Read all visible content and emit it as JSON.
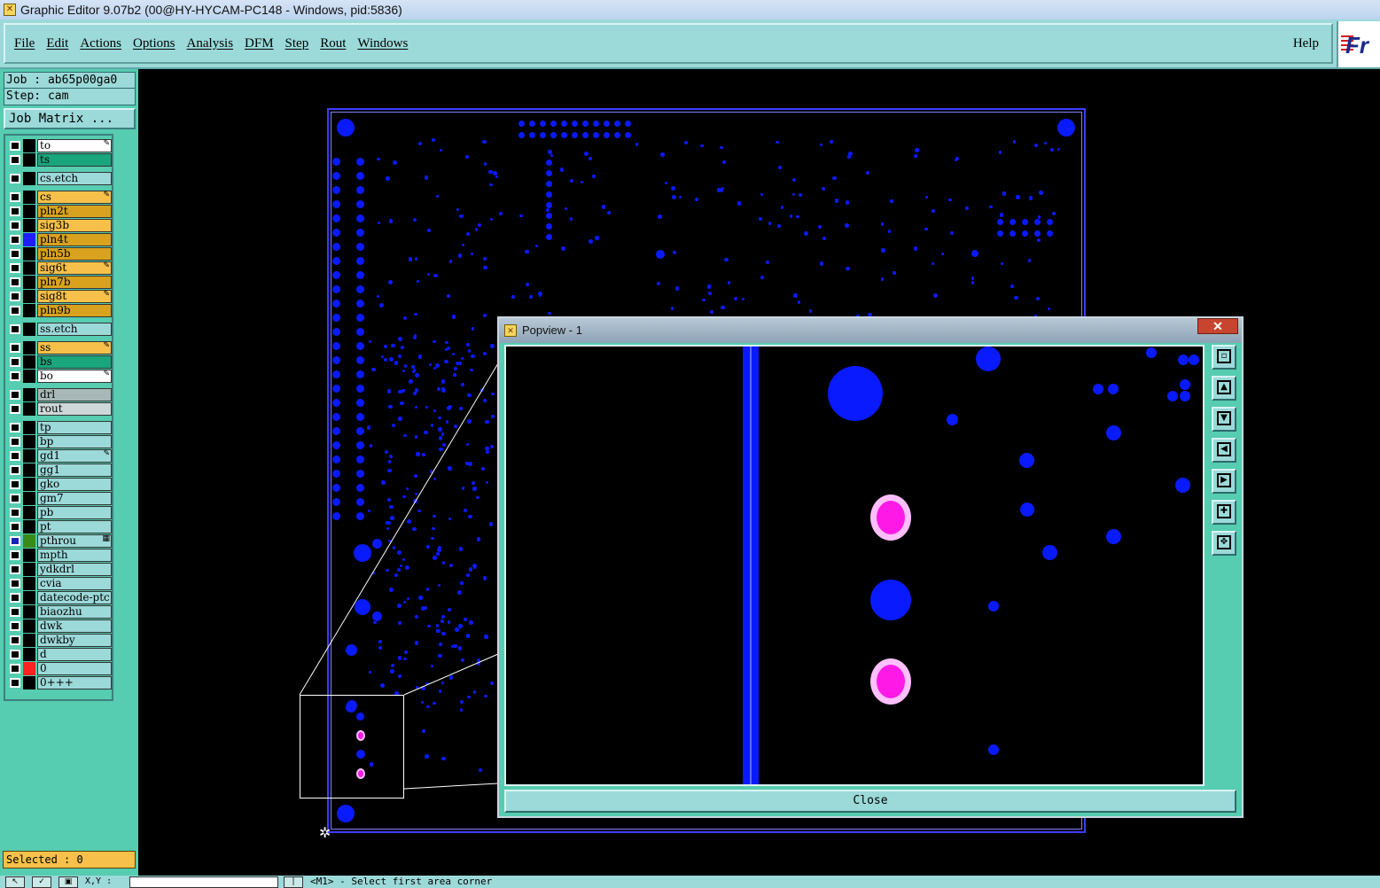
{
  "window": {
    "title": "Graphic Editor 9.07b2 (00@HY-HYCAM-PC148 - Windows, pid:5836)"
  },
  "menu": {
    "items": [
      "File",
      "Edit",
      "Actions",
      "Options",
      "Analysis",
      "DFM",
      "Step",
      "Rout",
      "Windows"
    ],
    "help": "Help",
    "logo": "Fr"
  },
  "job": {
    "job_line": "Job : ab65p00ga0",
    "step_line": "Step: cam",
    "matrix_button": "Job Matrix ..."
  },
  "layers": [
    {
      "name": "to",
      "color": "#ffffff",
      "mark": "pen"
    },
    {
      "name": "ts",
      "color": "#1aa67d"
    },
    {
      "name": "cs.etch",
      "color": "#9cd9d9"
    },
    {
      "name": "cs",
      "color": "#f6c04a",
      "mark": "pen"
    },
    {
      "name": "pln2t",
      "color": "#d9a21e"
    },
    {
      "name": "sig3b",
      "color": "#f6c04a"
    },
    {
      "name": "pln4t",
      "color": "#d9a21e",
      "swatch": "#1e1eff"
    },
    {
      "name": "pln5b",
      "color": "#d9a21e"
    },
    {
      "name": "sig6t",
      "color": "#f6c04a",
      "mark": "pen"
    },
    {
      "name": "pln7b",
      "color": "#d9a21e"
    },
    {
      "name": "sig8t",
      "color": "#f6c04a",
      "mark": "pen"
    },
    {
      "name": "pln9b",
      "color": "#d9a21e"
    },
    {
      "name": "ss.etch",
      "color": "#9cd9d9"
    },
    {
      "name": "ss",
      "color": "#f6c04a",
      "mark": "pen"
    },
    {
      "name": "bs",
      "color": "#1aa67d"
    },
    {
      "name": "bo",
      "color": "#ffffff",
      "mark": "pen"
    },
    {
      "name": "drl",
      "color": "#a8b8b8"
    },
    {
      "name": "rout",
      "color": "#cfd8d8"
    },
    {
      "name": "tp",
      "color": "#9cd9d9"
    },
    {
      "name": "bp",
      "color": "#9cd9d9"
    },
    {
      "name": "gd1",
      "color": "#9cd9d9",
      "mark": "pen"
    },
    {
      "name": "gg1",
      "color": "#9cd9d9"
    },
    {
      "name": "gko",
      "color": "#9cd9d9"
    },
    {
      "name": "gm7",
      "color": "#9cd9d9"
    },
    {
      "name": "pb",
      "color": "#9cd9d9"
    },
    {
      "name": "pt",
      "color": "#9cd9d9"
    },
    {
      "name": "pthrou",
      "color": "#9cd9d9",
      "swatch": "#3a8a1a",
      "mark": "grid"
    },
    {
      "name": "mpth",
      "color": "#9cd9d9"
    },
    {
      "name": "ydkdrl",
      "color": "#9cd9d9"
    },
    {
      "name": "cvia",
      "color": "#9cd9d9"
    },
    {
      "name": "datecode-ptc",
      "color": "#9cd9d9"
    },
    {
      "name": "biaozhu",
      "color": "#9cd9d9"
    },
    {
      "name": "dwk",
      "color": "#9cd9d9"
    },
    {
      "name": "dwkby",
      "color": "#9cd9d9"
    },
    {
      "name": "d",
      "color": "#9cd9d9"
    },
    {
      "name": "0",
      "color": "#9cd9d9",
      "swatch": "#ff2020"
    },
    {
      "name": "0+++",
      "color": "#9cd9d9"
    }
  ],
  "selected": "Selected : 0",
  "status": {
    "xy_label": "X,Y :",
    "message": "<M1> - Select first area corner"
  },
  "popview": {
    "title": "Popview - 1",
    "close_x": "✕",
    "close_button": "Close"
  },
  "colors": {
    "pad_blue": "#0a1aff",
    "pad_magenta": "#ff19e6",
    "panel_teal": "#56ccb0",
    "menu_teal": "#9cd9d9"
  }
}
